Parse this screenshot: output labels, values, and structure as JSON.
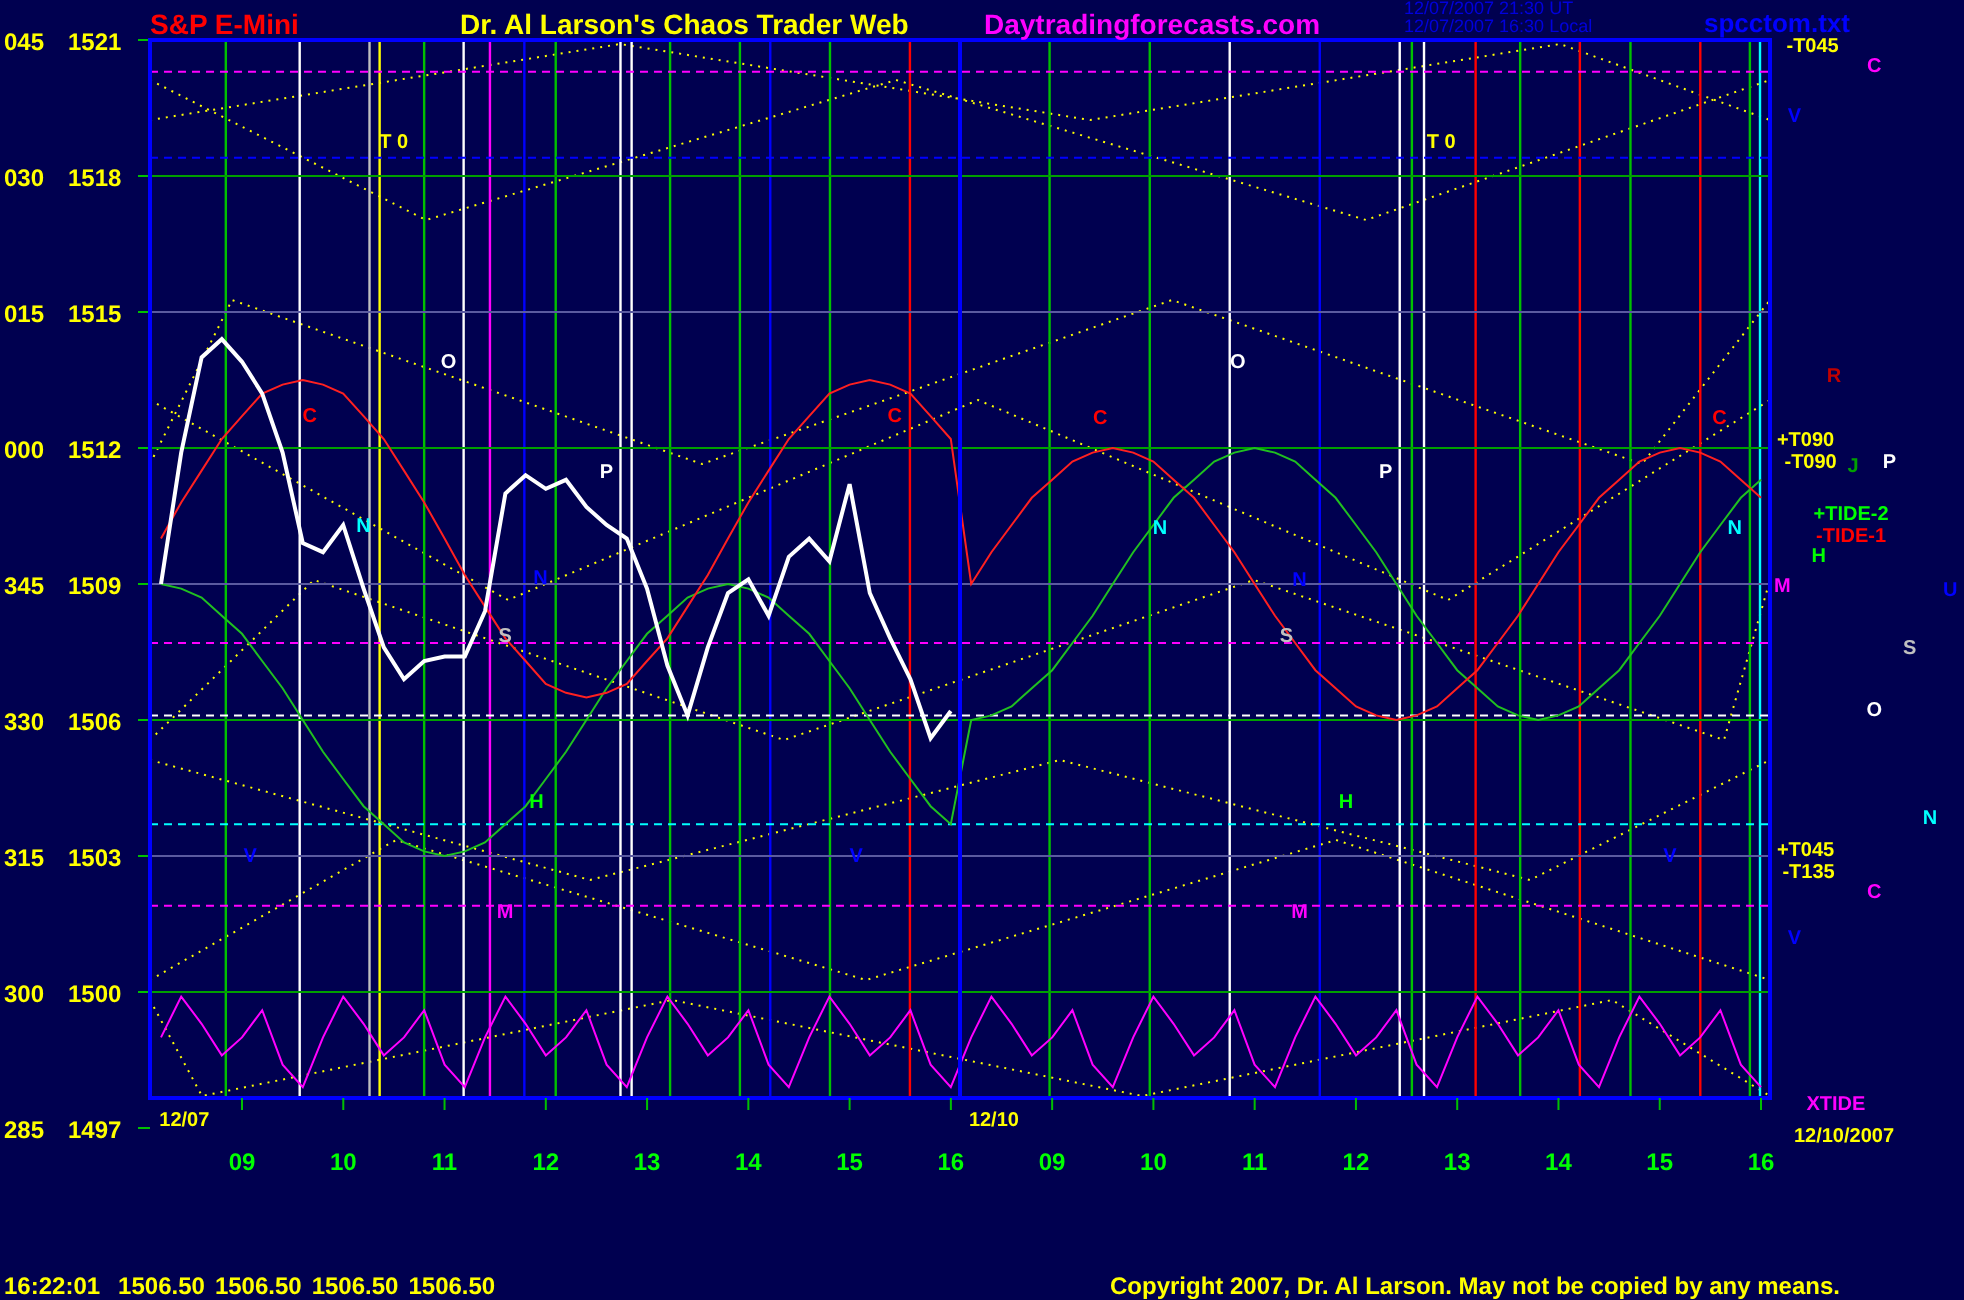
{
  "header": {
    "symbol": "S&P E-Mini",
    "title": "Dr. Al Larson's Chaos Trader Web",
    "site": "Daytradingforecasts.com",
    "timestamps": [
      "12/07/2007 21:30 UT",
      "12/07/2007 16:30 Local"
    ],
    "file": "spcctom.txt"
  },
  "chart": {
    "angle_labels": [
      "045",
      "030",
      "015",
      "000",
      "345",
      "330",
      "315",
      "300",
      "285"
    ],
    "chart_data": {
      "type": "line",
      "categories": [
        null,
        null,
        null,
        null,
        "09",
        null,
        null,
        null,
        null,
        "10",
        null,
        null,
        null,
        null,
        "11",
        null,
        null,
        null,
        null,
        "12",
        null,
        null,
        null,
        null,
        "13",
        null,
        null,
        null,
        null,
        "14",
        null,
        null,
        null,
        null,
        "15",
        null,
        null,
        null,
        null,
        "16",
        null,
        null,
        null,
        null,
        "09",
        null,
        null,
        null,
        null,
        "10",
        null,
        null,
        null,
        null,
        "11",
        null,
        null,
        null,
        null,
        "12",
        null,
        null,
        null,
        null,
        "13",
        null,
        null,
        null,
        null,
        "14",
        null,
        null,
        null,
        null,
        "15",
        null,
        null,
        null,
        null,
        "16"
      ],
      "series": [
        {
          "color": "#ffffff",
          "values": [
            1509.0,
            1511.9,
            1514.0,
            1514.4,
            1513.9,
            1513.2,
            1511.9,
            1509.9,
            1509.7,
            1510.3,
            1508.9,
            1507.6,
            1506.9,
            1507.3,
            1507.4,
            1507.4,
            1508.4,
            1511.0,
            1511.4,
            1511.1,
            1511.3,
            1510.7,
            1510.3,
            1510.0,
            1508.9,
            1507.2,
            1506.1,
            1507.6,
            1508.8,
            1509.1,
            1508.3,
            1509.6,
            1510.0,
            1509.5,
            1511.2,
            1508.8,
            1507.8,
            1506.9,
            1505.6,
            1506.2,
            null,
            null,
            null,
            null,
            null,
            null,
            null,
            null,
            null,
            null,
            null,
            null,
            null,
            null,
            null,
            null,
            null,
            null,
            null,
            null,
            null,
            null,
            null,
            null,
            null,
            null,
            null,
            null,
            null,
            null,
            null,
            null,
            null,
            null,
            null,
            null,
            null,
            null,
            null,
            null
          ]
        },
        {
          "color": "#ff2020",
          "values": [
            1510.0,
            1510.8,
            1511.5,
            1512.2,
            1512.7,
            1513.2,
            1513.4,
            1513.5,
            1513.4,
            1513.2,
            1512.7,
            1512.2,
            1511.5,
            1510.8,
            1510.0,
            1509.2,
            1508.5,
            1507.8,
            1507.3,
            1506.8,
            1506.6,
            1506.5,
            1506.6,
            1506.8,
            1507.3,
            1507.8,
            1508.5,
            1509.2,
            1510.0,
            1510.8,
            1511.5,
            1512.2,
            1512.7,
            1513.2,
            1513.4,
            1513.5,
            1513.4,
            1513.2,
            1512.7,
            1512.2,
            1509.0,
            1509.7,
            1510.3,
            1510.9,
            1511.3,
            1511.7,
            1511.9,
            1512.0,
            1511.9,
            1511.7,
            1511.3,
            1510.9,
            1510.3,
            1509.7,
            1509.0,
            1508.3,
            1507.7,
            1507.1,
            1506.7,
            1506.3,
            1506.1,
            1506.0,
            1506.1,
            1506.3,
            1506.7,
            1507.1,
            1507.7,
            1508.3,
            1509.0,
            1509.7,
            1510.3,
            1510.9,
            1511.3,
            1511.7,
            1511.9,
            1512.0,
            1511.9,
            1511.7,
            1511.3,
            1510.9
          ]
        },
        {
          "color": "#20c020",
          "values": [
            1509.0,
            1508.9,
            1508.7,
            1508.3,
            1507.9,
            1507.3,
            1506.7,
            1506.0,
            1505.3,
            1504.7,
            1504.1,
            1503.7,
            1503.3,
            1503.1,
            1503.0,
            1503.1,
            1503.3,
            1503.7,
            1504.1,
            1504.7,
            1505.3,
            1506.0,
            1506.7,
            1507.3,
            1507.9,
            1508.3,
            1508.7,
            1508.9,
            1509.0,
            1508.9,
            1508.7,
            1508.3,
            1507.9,
            1507.3,
            1506.7,
            1506.0,
            1505.3,
            1504.7,
            1504.1,
            1503.7,
            1506.0,
            1506.1,
            1506.3,
            1506.7,
            1507.1,
            1507.7,
            1508.3,
            1509.0,
            1509.7,
            1510.3,
            1510.9,
            1511.3,
            1511.7,
            1511.9,
            1512.0,
            1511.9,
            1511.7,
            1511.3,
            1510.9,
            1510.3,
            1509.7,
            1509.0,
            1508.3,
            1507.7,
            1507.1,
            1506.7,
            1506.3,
            1506.1,
            1506.0,
            1506.1,
            1506.3,
            1506.7,
            1507.1,
            1507.7,
            1508.3,
            1509.0,
            1509.7,
            1510.3,
            1510.9,
            1511.3
          ]
        },
        {
          "color": "#ff00ff",
          "values": [
            1499.0,
            1499.9,
            1499.3,
            1498.6,
            1499.0,
            1499.6,
            1498.4,
            1497.9,
            1499.0,
            1499.9,
            1499.3,
            1498.6,
            1499.0,
            1499.6,
            1498.4,
            1497.9,
            1499.0,
            1499.9,
            1499.3,
            1498.6,
            1499.0,
            1499.6,
            1498.4,
            1497.9,
            1499.0,
            1499.9,
            1499.3,
            1498.6,
            1499.0,
            1499.6,
            1498.4,
            1497.9,
            1499.0,
            1499.9,
            1499.3,
            1498.6,
            1499.0,
            1499.6,
            1498.4,
            1497.9,
            1499.0,
            1499.9,
            1499.3,
            1498.6,
            1499.0,
            1499.6,
            1498.4,
            1497.9,
            1499.0,
            1499.9,
            1499.3,
            1498.6,
            1499.0,
            1499.6,
            1498.4,
            1497.9,
            1499.0,
            1499.9,
            1499.3,
            1498.6,
            1499.0,
            1499.6,
            1498.4,
            1497.9,
            1499.0,
            1499.9,
            1499.3,
            1498.6,
            1499.0,
            1499.6,
            1498.4,
            1497.9,
            1499.0,
            1499.9,
            1499.3,
            1498.6,
            1499.0,
            1499.6,
            1498.4,
            1497.9
          ]
        }
      ],
      "ylim": [
        1497,
        1521
      ],
      "grid": true,
      "yticks": [
        {
          "value": 1521,
          "label": "1521"
        },
        {
          "value": 1518,
          "label": "1518"
        },
        {
          "value": 1515,
          "label": "1515"
        },
        {
          "value": 1512,
          "label": "1512"
        },
        {
          "value": 1509,
          "label": "1509"
        },
        {
          "value": 1506,
          "label": "1506"
        },
        {
          "value": 1503,
          "label": "1503"
        },
        {
          "value": 1500,
          "label": "1500"
        },
        {
          "value": 1497,
          "label": "1497"
        }
      ]
    },
    "markers": [
      {
        "text": "T 0",
        "color": "#ffff00"
      },
      {
        "text": "C",
        "color": "#ff0000"
      },
      {
        "text": "O",
        "color": "#ffffff"
      },
      {
        "text": "N",
        "color": "#00ffff"
      },
      {
        "text": "S",
        "color": "#c0c0c0"
      },
      {
        "text": "P",
        "color": "#ffffff"
      },
      {
        "text": "N",
        "color": "#0000ff"
      },
      {
        "text": "H",
        "color": "#00ff00"
      },
      {
        "text": "M",
        "color": "#ff00ff"
      },
      {
        "text": "V",
        "color": "#0000ff"
      },
      {
        "text": "C",
        "color": "#ff0000"
      },
      {
        "text": "V",
        "color": "#0000ff"
      },
      {
        "text": "T 0",
        "color": "#ffff00"
      },
      {
        "text": "C",
        "color": "#ff0000"
      },
      {
        "text": "O",
        "color": "#ffffff"
      },
      {
        "text": "N",
        "color": "#00ffff"
      },
      {
        "text": "P",
        "color": "#ffffff"
      },
      {
        "text": "N",
        "color": "#0000ff"
      },
      {
        "text": "S",
        "color": "#c0c0c0"
      },
      {
        "text": "H",
        "color": "#00ff00"
      },
      {
        "text": "M",
        "color": "#ff00ff"
      },
      {
        "text": "C",
        "color": "#ff0000"
      },
      {
        "text": "V",
        "color": "#0000ff"
      },
      {
        "text": "N",
        "color": "#00ffff"
      },
      {
        "text": "M",
        "color": "#ff00ff"
      },
      {
        "text": "-T045",
        "color": "#ffff00"
      },
      {
        "text": "C",
        "color": "#ff00ff"
      },
      {
        "text": "V",
        "color": "#0000ff"
      },
      {
        "text": "R",
        "color": "#c00000"
      },
      {
        "text": "+T090",
        "color": "#ffff00"
      },
      {
        "text": "-T090",
        "color": "#ffff00"
      },
      {
        "text": "J",
        "color": "#00a000"
      },
      {
        "text": "P",
        "color": "#ffffff"
      },
      {
        "text": "+TIDE-2",
        "color": "#00ff00"
      },
      {
        "text": "-TIDE-1",
        "color": "#ff0000"
      },
      {
        "text": "H",
        "color": "#00ff00"
      },
      {
        "text": "U",
        "color": "#0000ff"
      },
      {
        "text": "S",
        "color": "#c0c0c0"
      },
      {
        "text": "O",
        "color": "#ffffff"
      },
      {
        "text": "N",
        "color": "#00ffff"
      },
      {
        "text": "+T045",
        "color": "#ffff00"
      },
      {
        "text": "-T135",
        "color": "#ffff00"
      },
      {
        "text": "C",
        "color": "#ff00ff"
      },
      {
        "text": "V",
        "color": "#0000ff"
      },
      {
        "text": "XTIDE",
        "color": "#ff00ff"
      },
      {
        "text": "12/07",
        "color": "#ffff00"
      },
      {
        "text": "12/10",
        "color": "#ffff00"
      },
      {
        "text": "12/10/2007",
        "color": "#ffff00"
      }
    ]
  },
  "footer": {
    "time": "16:22:01",
    "quotes": [
      "1506.50",
      "1506.50",
      "1506.50",
      "1506.50"
    ],
    "copyright": "Copyright 2007, Dr. Al Larson. May not be copied by any means."
  }
}
